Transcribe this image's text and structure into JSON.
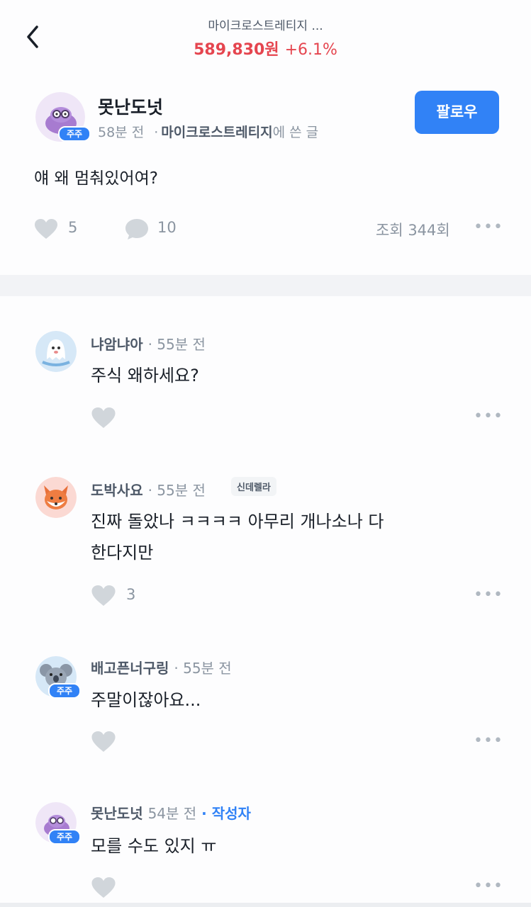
{
  "header": {
    "title": "마이크로스트레티지 ...",
    "price": "589,830원",
    "change": "+6.1%"
  },
  "post": {
    "author": "못난도넛",
    "time": "58분 전",
    "separator": "·",
    "stock": "마이크로스트레티지",
    "suffix": "에 쓴 글",
    "badge": "주주",
    "follow_label": "팔로우",
    "body": "얘 왜 멈춰있어여?",
    "likes": "5",
    "comments": "10",
    "views": "조회 344회"
  },
  "comments": [
    {
      "author": "냐암냐아",
      "time": "· 55분 전",
      "text": "주식 왜하세요?",
      "likes": "",
      "badge": ""
    },
    {
      "author": "도박사요",
      "time": "· 55분 전",
      "tag": "신데렐라",
      "text_line1": "진짜 돌았나 ㅋㅋㅋㅋ 아무리 개나소나 다",
      "text_line2": "한다지만",
      "likes": "3",
      "badge": ""
    },
    {
      "author": "배고픈너구링",
      "time": "· 55분 전",
      "text": "주말이잖아요...",
      "likes": "",
      "badge": "주주"
    },
    {
      "author": "못난도넛",
      "time": "54분 전",
      "author_tag": "· 작성자",
      "text": "모를 수도 있지 ㅠ",
      "likes": "",
      "badge": "주주"
    }
  ],
  "icons": {
    "back": "chevron-left-icon",
    "like": "heart-icon",
    "comment": "speech-bubble-icon",
    "more": "more-dots-icon"
  },
  "colors": {
    "accent": "#3182f6",
    "price_up": "#e5454f",
    "muted": "#8b95a1",
    "icon_gray": "#d1d6db"
  },
  "more_dots": "•••"
}
